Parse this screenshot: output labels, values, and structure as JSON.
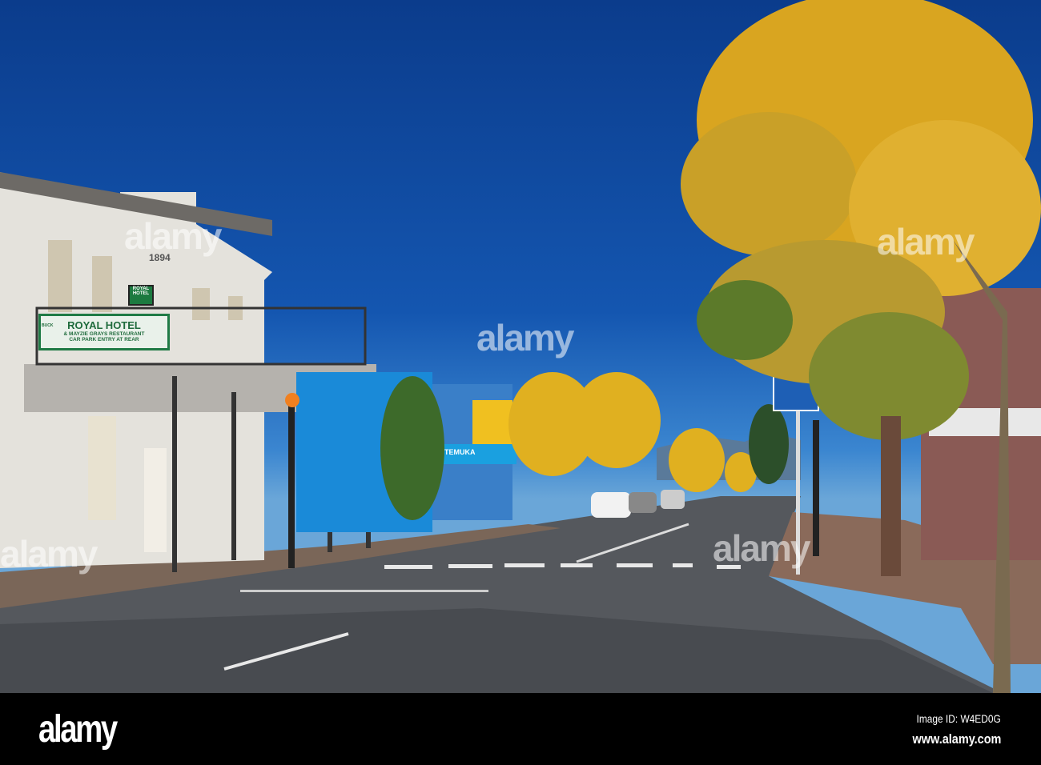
{
  "photo": {
    "hotel_date": "1894",
    "hotel_sign": {
      "title": "ROYAL HOTEL",
      "line2": "& MAYZIE GRAYS RESTAURANT",
      "line3": "CAR PARK ENTRY AT REAR",
      "badge": "BUCK"
    },
    "small_sign": "ROYAL HOTEL",
    "shop_sign": "TEMUKA",
    "watermark": "alamy"
  },
  "footer": {
    "logo": "alamy",
    "image_id": "Image ID: W4ED0G",
    "website": "www.alamy.com"
  }
}
